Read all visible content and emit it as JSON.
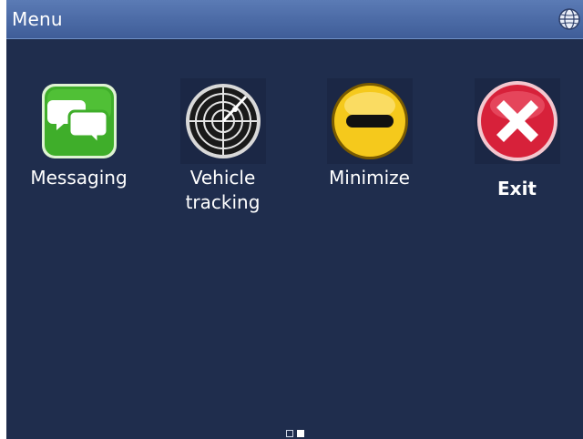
{
  "titlebar": {
    "title": "Menu",
    "icon": "globe-icon"
  },
  "tiles": [
    {
      "label": "Messaging",
      "icon": "chat-bubbles-icon"
    },
    {
      "label": "Vehicle\ntracking",
      "icon": "radar-icon"
    },
    {
      "label": "Minimize",
      "icon": "minimize-icon"
    },
    {
      "label": "Exit",
      "icon": "close-icon"
    }
  ],
  "pager": {
    "pages": 2,
    "current_page": 2
  },
  "colors": {
    "background": "#1f2d4d",
    "titlebar": "#4b6aa5",
    "messaging": "#3fae2a",
    "minimize": "#f2c21a",
    "exit": "#d7213a"
  }
}
